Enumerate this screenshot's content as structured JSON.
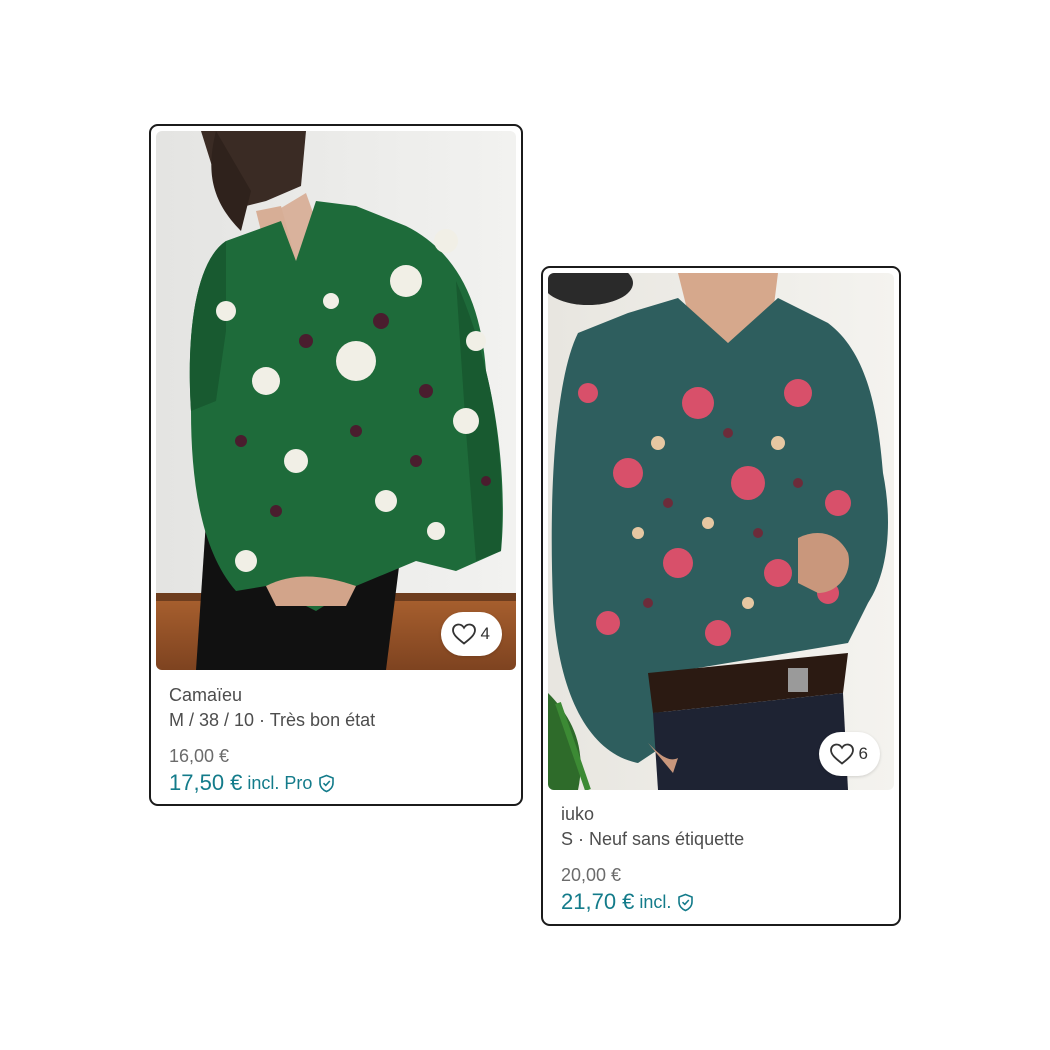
{
  "listings": [
    {
      "brand": "Camaïeu",
      "details": "M / 38 / 10 · Très bon état",
      "price": "16,00 €",
      "price_incl": "17,50 €",
      "price_incl_suffix": "incl. Pro",
      "favourites": "4",
      "photo_description": "green-floral-blouse-photo"
    },
    {
      "brand": "iuko",
      "details": "S · Neuf sans étiquette",
      "price": "20,00 €",
      "price_incl": "21,70 €",
      "price_incl_suffix": "incl.",
      "favourites": "6",
      "photo_description": "teal-paisley-shirt-photo"
    }
  ],
  "colors": {
    "accent": "#137b8a",
    "card_border": "#1b1b1b",
    "secondary_text": "#4d4d4d"
  },
  "icons": {
    "favourite": "heart-icon",
    "buyer_protection": "shield-check-icon"
  }
}
